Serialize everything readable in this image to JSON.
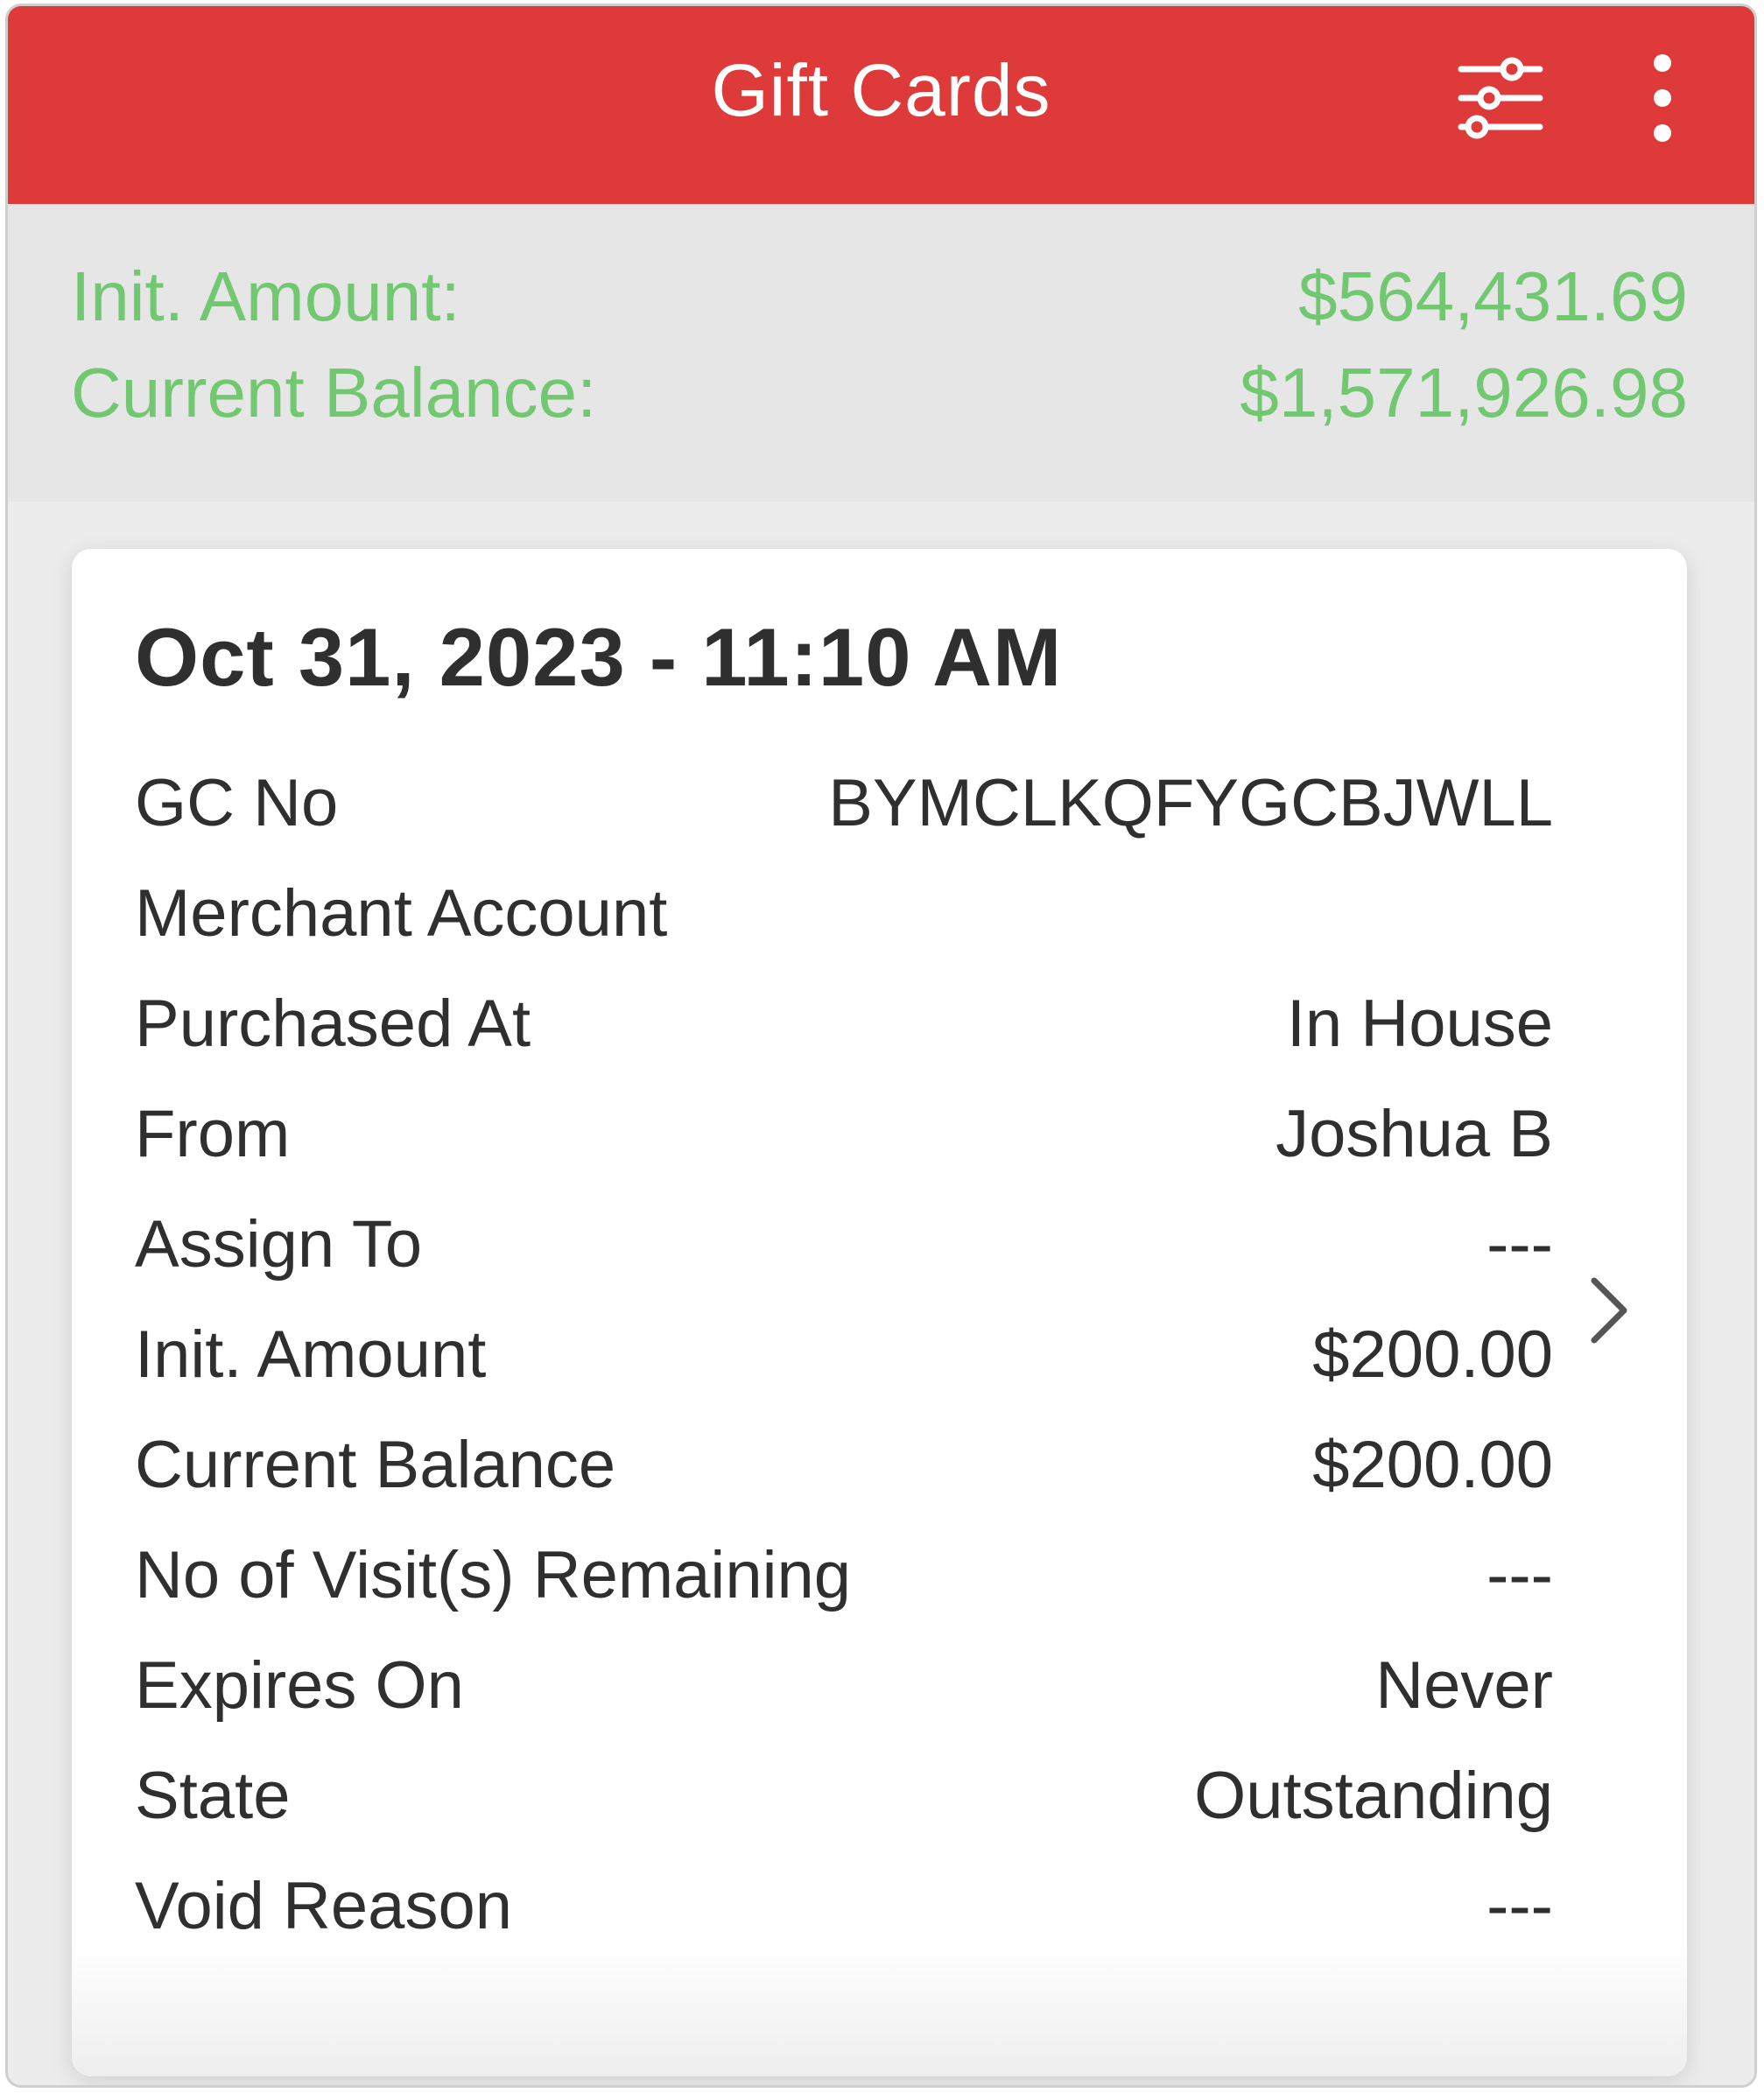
{
  "header": {
    "title": "Gift Cards",
    "filter_icon": "sliders-icon",
    "more_icon": "more-vertical-icon",
    "color": "#de3a3a"
  },
  "summary": {
    "init_amount_label": "Init. Amount:",
    "init_amount_value": "$564,431.69",
    "current_balance_label": "Current Balance:",
    "current_balance_value": "$1,571,926.98",
    "color": "#72c870"
  },
  "card": {
    "title": "Oct 31, 2023 - 11:10 AM",
    "chevron_icon": "chevron-right-icon",
    "rows": [
      {
        "label": "GC No",
        "value": "BYMCLKQFYGCBJWLL"
      },
      {
        "label": "Merchant Account",
        "value": ""
      },
      {
        "label": "Purchased At",
        "value": "In House"
      },
      {
        "label": "From",
        "value": "Joshua B"
      },
      {
        "label": "Assign To",
        "value": "---"
      },
      {
        "label": "Init. Amount",
        "value": "$200.00"
      },
      {
        "label": "Current Balance",
        "value": "$200.00"
      },
      {
        "label": "No of Visit(s) Remaining",
        "value": "---"
      },
      {
        "label": "Expires On",
        "value": "Never"
      },
      {
        "label": "State",
        "value": "Outstanding"
      },
      {
        "label": "Void Reason",
        "value": "---"
      }
    ]
  }
}
